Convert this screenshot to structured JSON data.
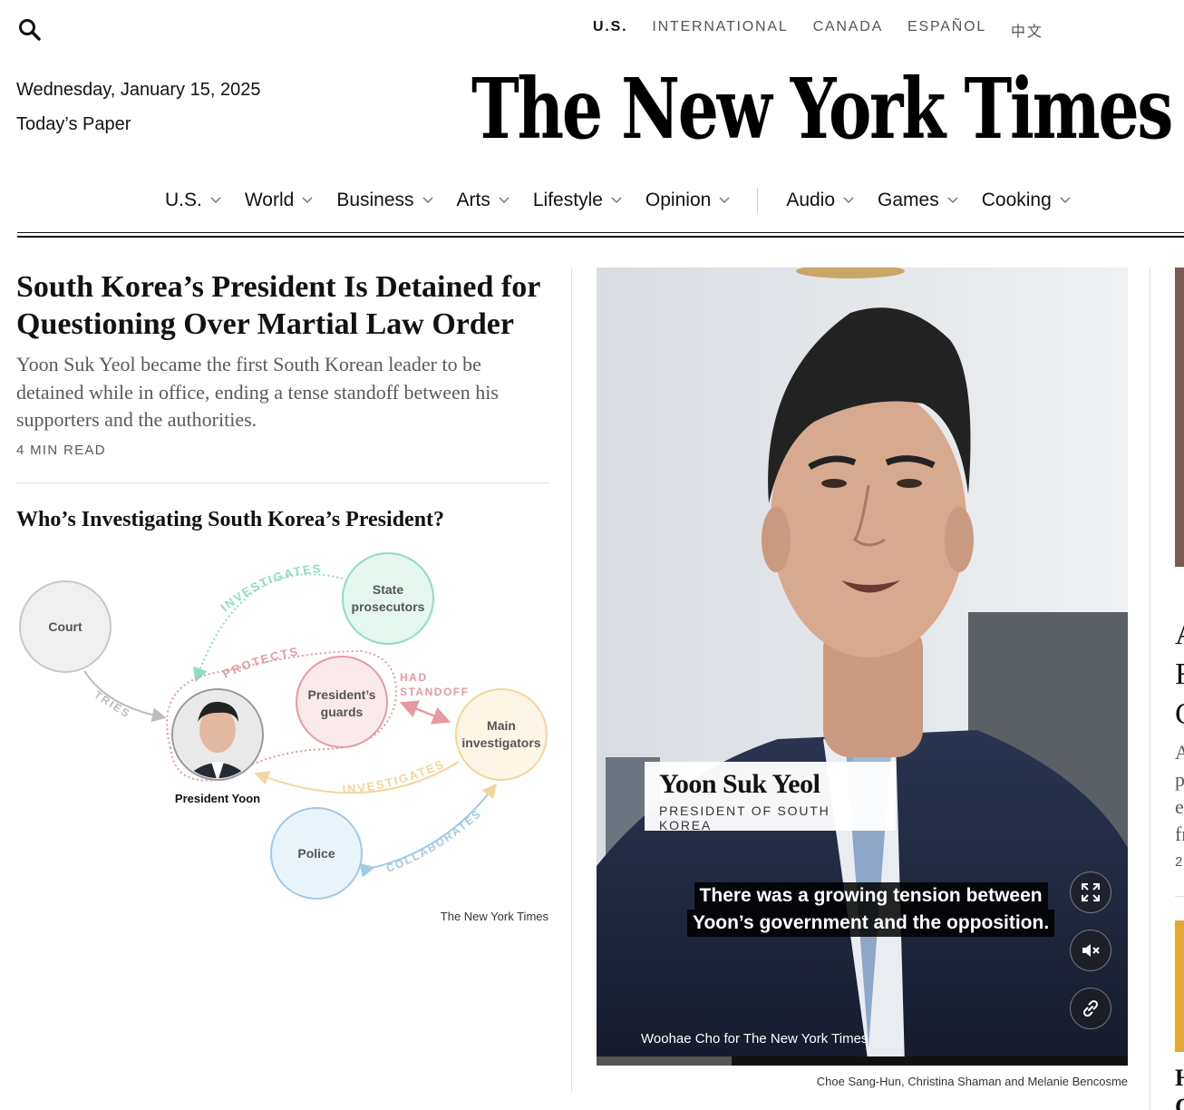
{
  "header": {
    "editions": [
      "U.S.",
      "INTERNATIONAL",
      "CANADA",
      "ESPAÑOL",
      "中文"
    ],
    "date": "Wednesday, January 15, 2025",
    "todays_paper": "Today’s Paper",
    "logo_text": "The New York Times",
    "icons": {
      "search": "search-icon",
      "chevron": "chevron-down-icon"
    }
  },
  "nav": {
    "primary": [
      "U.S.",
      "World",
      "Business",
      "Arts",
      "Lifestyle",
      "Opinion"
    ],
    "secondary": [
      "Audio",
      "Games",
      "Cooking"
    ]
  },
  "lead_story": {
    "headline": "South Korea’s President Is Detained for Questioning Over Martial Law Order",
    "summary": "Yoon Suk Yeol became the first South Korean leader to be detained while in office, ending a tense standoff between his supporters and the authorities.",
    "read_time": "4 MIN READ"
  },
  "graphic": {
    "title": "Who’s Investigating South Korea’s President?",
    "nodes": {
      "court": "Court",
      "state_prosecutors": [
        "State",
        "prosecutors"
      ],
      "presidents_guards": [
        "President’s",
        "guards"
      ],
      "main_investigators": [
        "Main",
        "investigators"
      ],
      "police": "Police",
      "president_yoon": "President Yoon"
    },
    "edges": {
      "investigates_1": "INVESTIGATES",
      "protects": "PROTECTS",
      "had_standoff": [
        "HAD",
        "STANDOFF"
      ],
      "tries": "TRIES",
      "investigates_2": "INVESTIGATES",
      "collaborates": "COLLABORATES"
    },
    "colors": {
      "court": "#bdbdbd",
      "prosecutors": "#8fdcc4",
      "guards": "#e79aa3",
      "investigators": "#f3d69a",
      "police": "#9fcbe6"
    },
    "credit": "The New York Times"
  },
  "video": {
    "lower_third_name": "Yoon Suk Yeol",
    "lower_third_title": "PRESIDENT OF SOUTH KOREA",
    "caption_line1": "There was a growing tension between",
    "caption_line2": "Yoon’s government and the opposition.",
    "photo_credit": "Woohae Cho for The New York Times",
    "progress_fraction": 0.255,
    "byline": "Choe Sang-Hun, Christina Shaman and Melanie Bencosme",
    "controls": [
      "fullscreen-icon",
      "mute-icon",
      "link-icon"
    ]
  },
  "right_column": {
    "clipped_letters": [
      "A",
      "F",
      "C"
    ],
    "clipped_summary_letters": [
      "A",
      "p",
      "e",
      "fr"
    ],
    "clipped_readtime": "2",
    "clipped_bottom_letters": [
      "H",
      "C"
    ]
  }
}
